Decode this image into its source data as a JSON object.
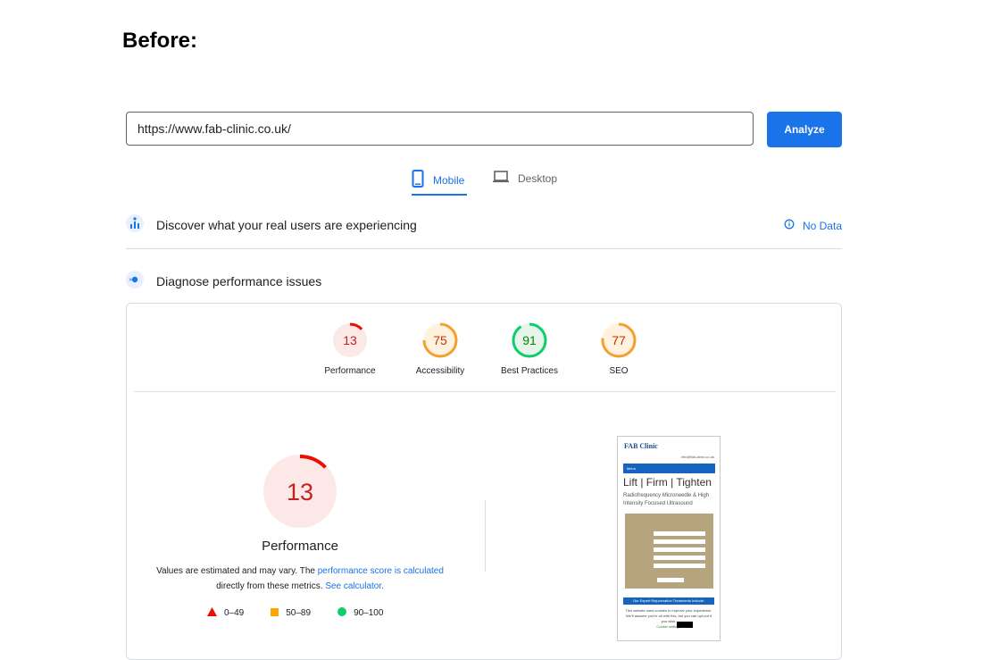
{
  "heading": "Before:",
  "url_input": {
    "value": "https://www.fab-clinic.co.uk/"
  },
  "analyze_button": "Analyze",
  "tabs": [
    {
      "label": "Mobile",
      "active": true,
      "icon": "mobile-phone-icon"
    },
    {
      "label": "Desktop",
      "active": false,
      "icon": "laptop-icon"
    }
  ],
  "field_data": {
    "title": "Discover what your real users are experiencing",
    "status": "No Data",
    "icon": "users-chart-icon"
  },
  "lab_data": {
    "title": "Diagnose performance issues",
    "icon": "diagnose-icon"
  },
  "scores": [
    {
      "label": "Performance",
      "value": 13,
      "color": "#eb0f00",
      "bg": "#fce8e6"
    },
    {
      "label": "Accessibility",
      "value": 75,
      "color": "#f4a02f",
      "bg": "#fff3e0"
    },
    {
      "label": "Best Practices",
      "value": 91,
      "color": "#0cce6b",
      "bg": "#e6f4ea"
    },
    {
      "label": "SEO",
      "value": 77,
      "color": "#f4a02f",
      "bg": "#fff3e0"
    }
  ],
  "performance_detail": {
    "score": "13",
    "label": "Performance",
    "desc_prefix": "Values are estimated and may vary. The ",
    "desc_link1": "performance score is calculated",
    "desc_middle": " directly from these metrics. ",
    "desc_link2": "See calculator."
  },
  "legend": [
    {
      "range": "0–49",
      "shape": "triangle",
      "color": "#eb0f00"
    },
    {
      "range": "50–89",
      "shape": "square",
      "color": "#ffa400"
    },
    {
      "range": "90–100",
      "shape": "circle",
      "color": "#0cce6b"
    }
  ],
  "screenshot": {
    "logo": "FAB Clinic",
    "contact": "info@fab-clinic.co.uk",
    "menu": "Menu",
    "hero": "Lift | Firm | Tighten",
    "sub": "Radiofrequency Microneedle & High Intensity Focused Ultrasound",
    "banner": "Our Expert Rejuvenation Treatments Include:",
    "cookie": "This website uses cookies to improve your experience. We'll assume you're ok with this, but you can opt-out if you wish.",
    "cookie_settings": "Cookie settings"
  }
}
